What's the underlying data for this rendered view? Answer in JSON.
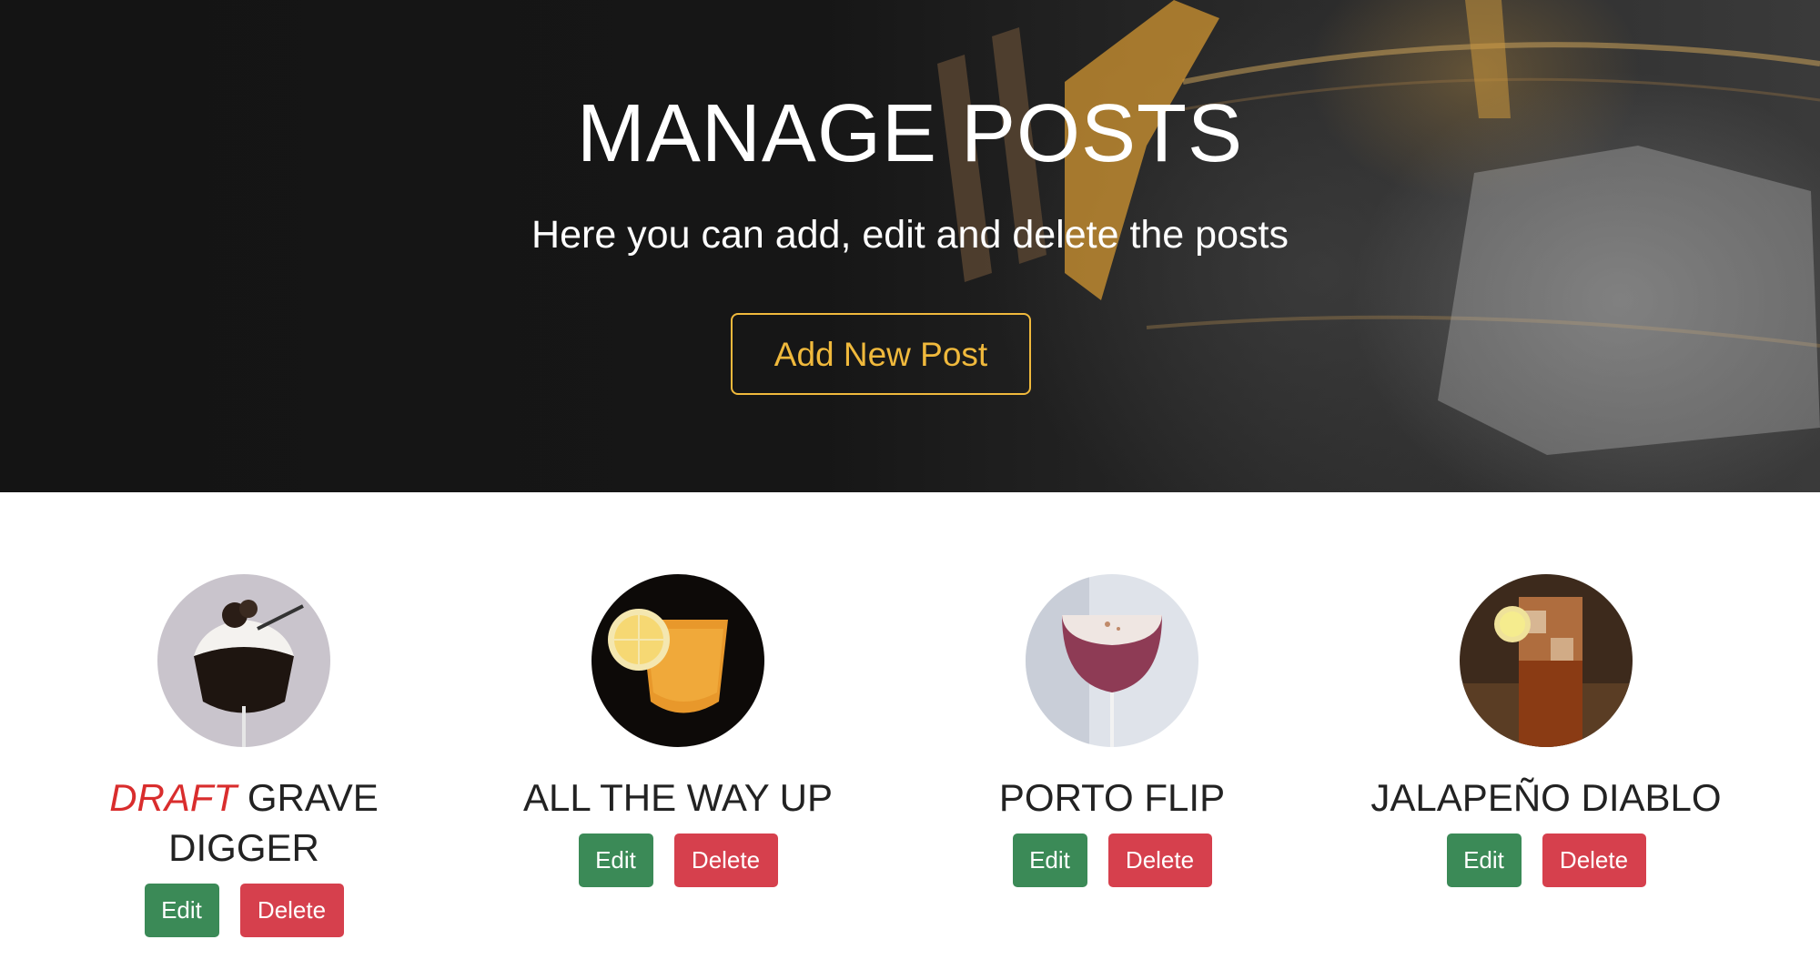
{
  "hero": {
    "title": "MANAGE POSTS",
    "subtitle": "Here you can add, edit and delete the posts",
    "add_button_label": "Add New Post",
    "accent_color": "#f0b93c"
  },
  "posts": [
    {
      "draft_label": "DRAFT",
      "title": "GRAVE DIGGER",
      "image": "espresso-martini-cocktail-image",
      "edit_label": "Edit",
      "delete_label": "Delete"
    },
    {
      "title": "ALL THE WAY UP",
      "image": "orange-cocktail-lemon-slice-image",
      "edit_label": "Edit",
      "delete_label": "Delete"
    },
    {
      "title": "PORTO FLIP",
      "image": "foamy-pink-coupe-cocktail-image",
      "edit_label": "Edit",
      "delete_label": "Delete"
    },
    {
      "title": "JALAPEÑO DIABLO",
      "image": "highball-iced-cocktail-image",
      "edit_label": "Edit",
      "delete_label": "Delete"
    }
  ],
  "colors": {
    "edit": "#3b8a57",
    "delete": "#d6404d",
    "draft": "#d92d2d"
  }
}
